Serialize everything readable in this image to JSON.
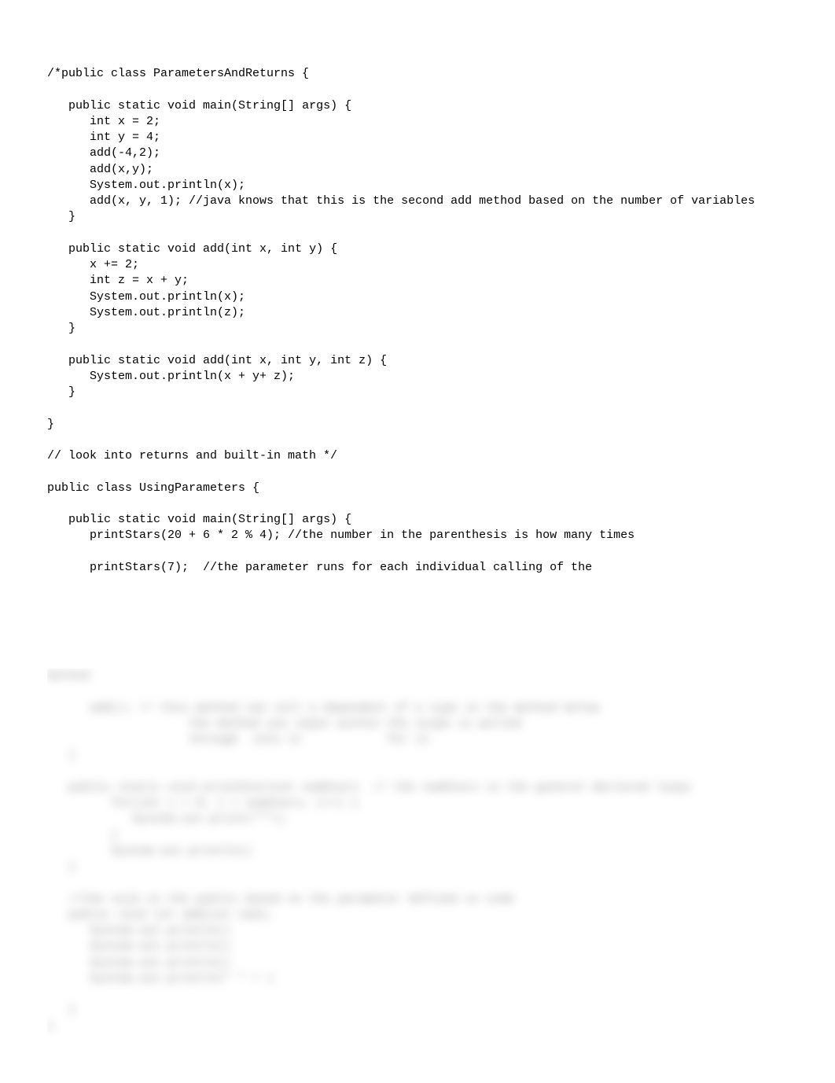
{
  "code": {
    "visible": "/*public class ParametersAndReturns {\n\n   public static void main(String[] args) {\n      int x = 2;\n      int y = 4;\n      add(-4,2);\n      add(x,y);\n      System.out.println(x);\n      add(x, y, 1); //java knows that this is the second add method based on the number of variables\n   }\n\n   public static void add(int x, int y) {\n      x += 2;\n      int z = x + y;\n      System.out.println(x);\n      System.out.println(z);\n   }\n\n   public static void add(int x, int y, int z) {\n      System.out.println(x + y+ z);\n   }\n\n}\n\n// look into returns and built-in math */\n\npublic class UsingParameters {\n\n   public static void main(String[] args) {\n      printStars(20 + 6 * 2 % 4); //the number in the parenthesis is how many times\n\n      printStars(7);  //the parameter runs for each individual calling of the",
    "blurred": "method\n\n      add(); // this method can call a dependent of a type in the method below\n                    the method you input within the scope is pulled\n                    through  into it            for it\n   }\n\n   public static void printStarsint numStars  // the numStars is the general declared loops\n         for(int i = 0; i < numStars; i++) {\n            System.out.print(\"*\");\n         }\n         System.out.println()\n   }\n\n   //the void in the public based on the parameter defined in code\n   public void int add(int num);\n      System.out.println()\n      System.out.println()\n      System.out.println()\n      System.out.println(\" \" + )\n\n   }\n}"
  }
}
